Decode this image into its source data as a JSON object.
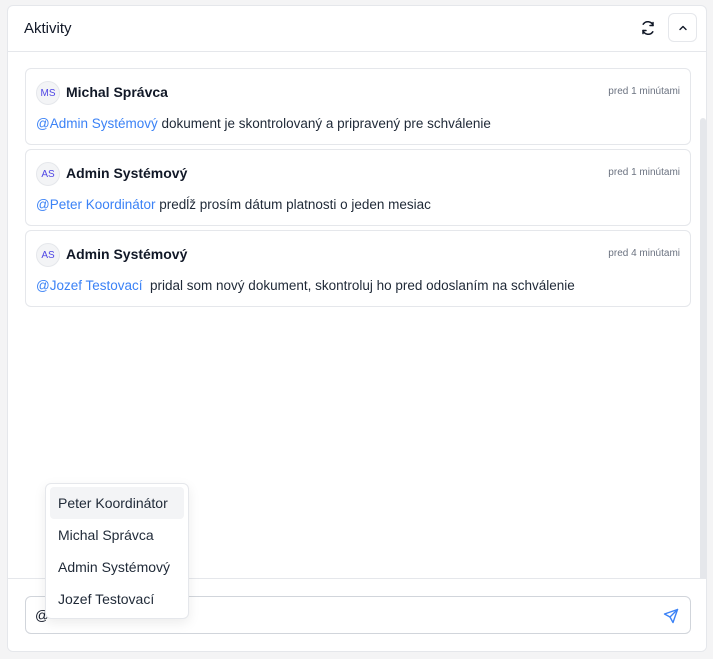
{
  "panel": {
    "title": "Aktivity"
  },
  "icons": {
    "refresh": "refresh-icon",
    "collapse": "chevron-up-icon",
    "send": "send-icon"
  },
  "activities": [
    {
      "initials": "MS",
      "author": "Michal Správca",
      "time": "pred 1 minútami",
      "mention": "@Admin Systémový",
      "text": " dokument je skontrolovaný a pripravený pre schválenie"
    },
    {
      "initials": "AS",
      "author": "Admin Systémový",
      "time": "pred 1 minútami",
      "mention": "@Peter Koordinátor",
      "text": " predĺž prosím dátum platnosti o jeden mesiac"
    },
    {
      "initials": "AS",
      "author": "Admin Systémový",
      "time": "pred 4 minútami",
      "mention": "@Jozef Testovací",
      "text": "  pridal som nový dokument, skontroluj ho pred odoslaním na schválenie"
    }
  ],
  "mention_dropdown": {
    "options": [
      "Peter Koordinátor",
      "Michal Správca",
      "Admin Systémový",
      "Jozef Testovací"
    ],
    "highlighted": "Peter Koordinátor"
  },
  "composer": {
    "value": "@"
  },
  "colors": {
    "mention": "#3b82f6",
    "avatar_text": "#4f46e5",
    "border": "#e5e7eb"
  }
}
